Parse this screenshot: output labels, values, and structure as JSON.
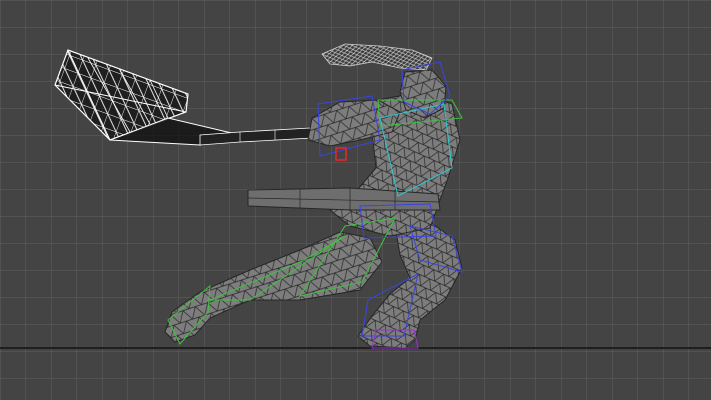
{
  "viewport": {
    "type": "3d-perspective-viewport",
    "display_mode": "wireframe-over-shaded",
    "grid_visible": true,
    "home_grid_visible": true,
    "overlay_labels": []
  },
  "scene": {
    "objects": [
      {
        "name": "character-body",
        "kind": "polygon-mesh",
        "shading": "shaded-with-edges"
      },
      {
        "name": "sword-blade",
        "kind": "polygon-mesh",
        "shading": "wireframe",
        "selected": true
      },
      {
        "name": "sword-handle",
        "kind": "polygon-mesh",
        "shading": "wireframe",
        "selected": true
      },
      {
        "name": "sheathed-weapon",
        "kind": "polygon-mesh",
        "shading": "shaded"
      },
      {
        "name": "biped-rig",
        "kind": "bone-rig",
        "shading": "wireframe"
      }
    ]
  },
  "colors": {
    "background": "#444444",
    "grid_line": "#5f5f5f",
    "horizon": "#1f1f1f",
    "mesh_fill": "#7d7d7d",
    "mesh_edge": "#262626",
    "selection_wire": "#ffffff",
    "rig_green": "#3fc23f",
    "rig_blue": "#3a44e0",
    "rig_cyan": "#2ec8d0",
    "rig_magenta": "#9a2fd8",
    "rig_red": "#e02828"
  }
}
